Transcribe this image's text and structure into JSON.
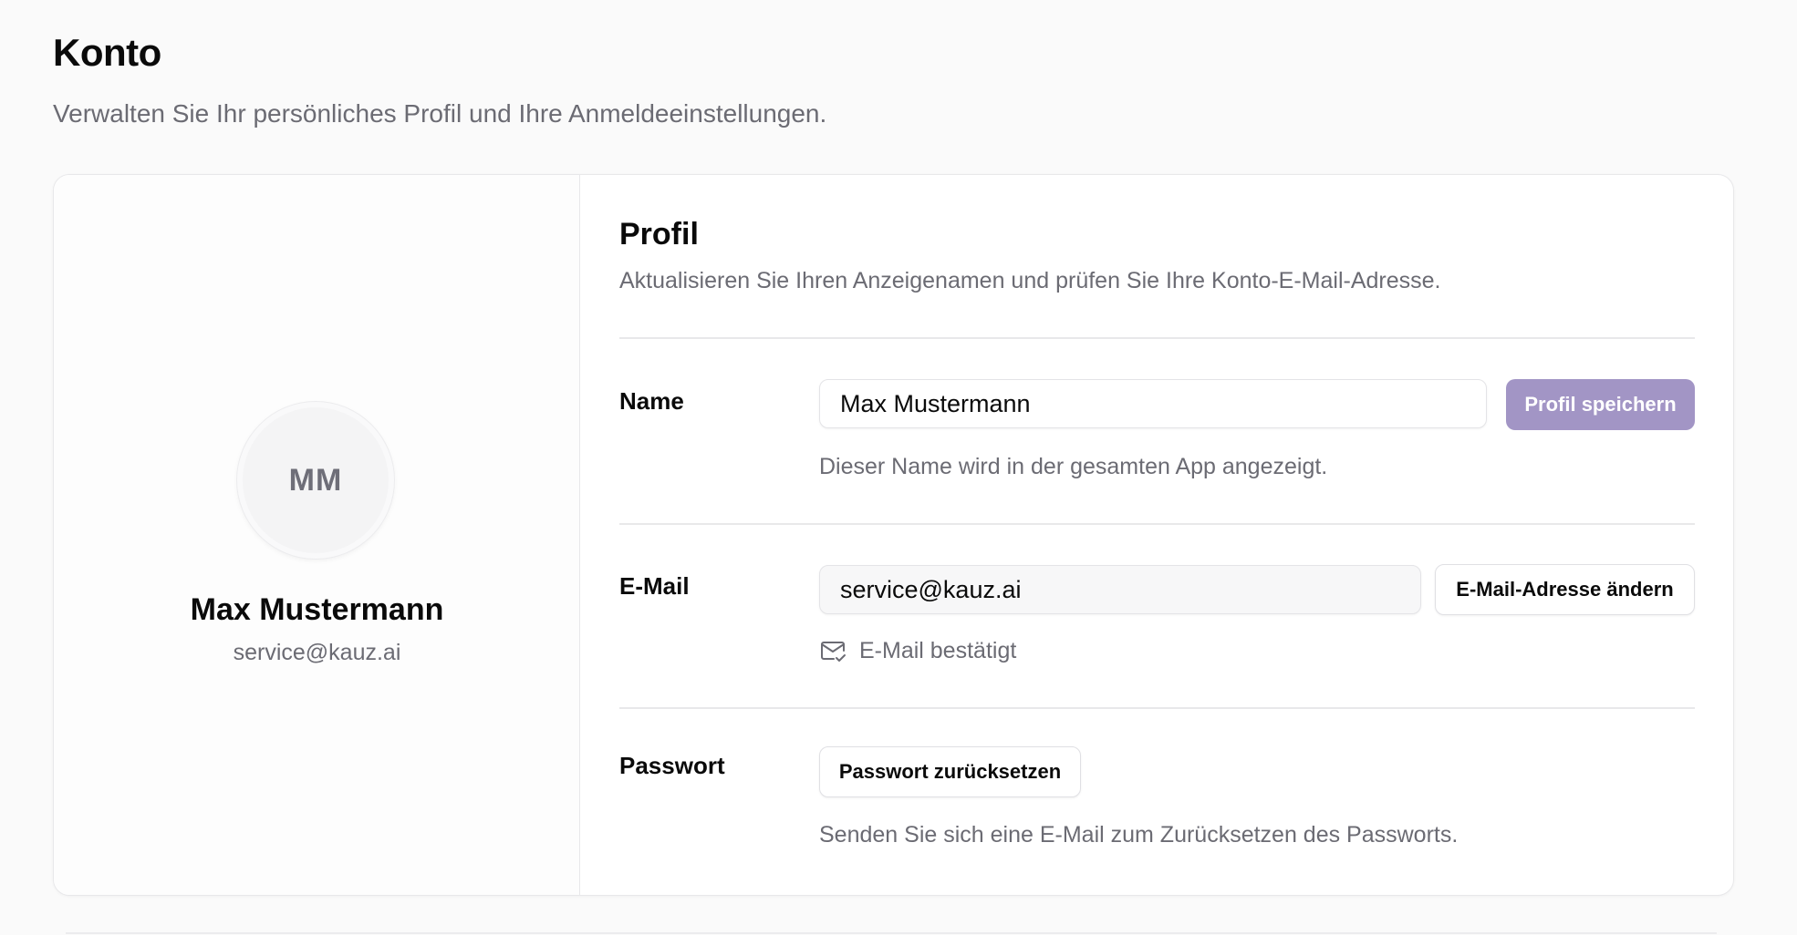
{
  "header": {
    "title": "Konto",
    "subtitle": "Verwalten Sie Ihr persönliches Profil und Ihre Anmeldeeinstellungen."
  },
  "profile_summary": {
    "initials": "MM",
    "name": "Max Mustermann",
    "email": "service@kauz.ai"
  },
  "profile_section": {
    "title": "Profil",
    "description": "Aktualisieren Sie Ihren Anzeigenamen und prüfen Sie Ihre Konto-E-Mail-Adresse."
  },
  "name_row": {
    "label": "Name",
    "value": "Max Mustermann",
    "save_button": "Profil speichern",
    "helper": "Dieser Name wird in der gesamten App angezeigt."
  },
  "email_row": {
    "label": "E-Mail",
    "value": "service@kauz.ai",
    "change_button": "E-Mail-Adresse ändern",
    "verified_text": "E-Mail bestätigt",
    "verified_icon": "mail-check-icon"
  },
  "password_row": {
    "label": "Passwort",
    "reset_button": "Passwort zurücksetzen",
    "helper": "Senden Sie sich eine E-Mail zum Zurücksetzen des Passworts."
  },
  "colors": {
    "primary_button": "#a295c5",
    "muted_text": "#6b6b73",
    "border": "#e8e8ea"
  }
}
